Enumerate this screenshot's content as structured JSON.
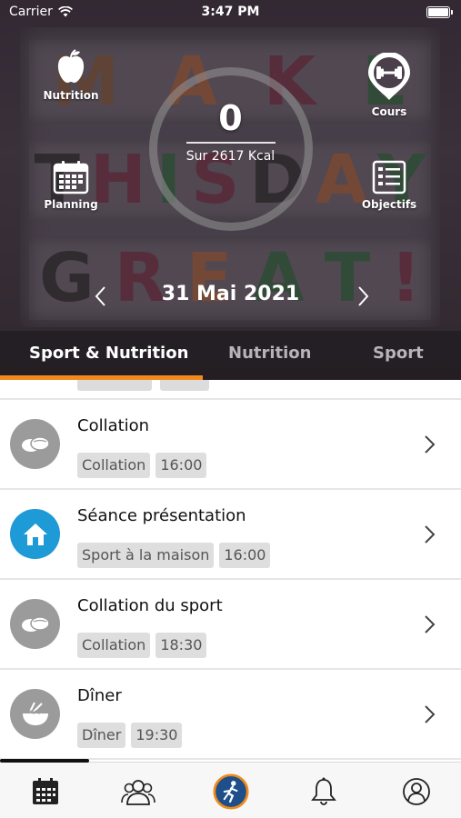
{
  "status_bar": {
    "carrier": "Carrier",
    "time": "3:47 PM"
  },
  "hero": {
    "lightbox_rows": [
      {
        "letters": [
          "M",
          "A",
          "K",
          "E"
        ],
        "colors": [
          "#8c5a3a",
          "#b0643a",
          "#7a2e44",
          "#2f6a3d"
        ]
      },
      {
        "letters": [
          "T",
          "H",
          "I",
          "S",
          "D",
          "A",
          "Y"
        ],
        "colors": [
          "#2b2b2b",
          "#7a2e44",
          "#2f6a3d",
          "#7a2e44",
          "#2b2b2b",
          "#b0643a",
          "#2f6a3d"
        ]
      },
      {
        "letters": [
          "G",
          "R",
          "E",
          "A",
          "T",
          "!"
        ],
        "colors": [
          "#2b2b2b",
          "#7a2e44",
          "#b0643a",
          "#2f6a3d",
          "#2f6a3d",
          "#7a2e44"
        ]
      }
    ],
    "nutrition_label": "Nutrition",
    "cours_label": "Cours",
    "planning_label": "Planning",
    "objectifs_label": "Objectifs",
    "kcal_value": "0",
    "kcal_target": "Sur 2617 Kcal",
    "date": "31 Mai 2021"
  },
  "tabs": [
    "Sport & Nutrition",
    "Nutrition",
    "Sport"
  ],
  "items": [
    {
      "title": "Collation",
      "tags": [
        "Collation",
        "16:00"
      ],
      "icon": "snack-icon",
      "color": "#9b9b9b"
    },
    {
      "title": "Séance présentation",
      "tags": [
        "Sport à la maison",
        "16:00"
      ],
      "icon": "home-icon",
      "color": "#1e9ad6"
    },
    {
      "title": "Collation du sport",
      "tags": [
        "Collation",
        "18:30"
      ],
      "icon": "snack-icon",
      "color": "#9b9b9b"
    },
    {
      "title": "Dîner",
      "tags": [
        "Dîner",
        "19:30"
      ],
      "icon": "bowl-icon",
      "color": "#9b9b9b"
    }
  ],
  "bottom_nav": [
    "calendar-icon",
    "users-icon",
    "runner-icon",
    "bell-icon",
    "profile-icon"
  ],
  "accent_color": "#f08a1c"
}
